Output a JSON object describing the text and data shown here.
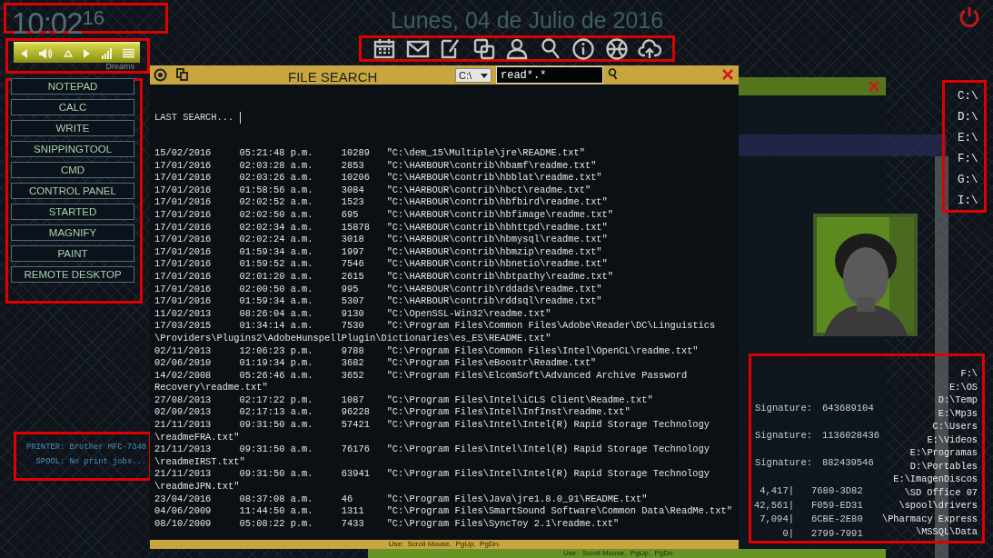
{
  "clock": {
    "time": "10:02",
    "seconds": "16",
    "highlighted": true
  },
  "date": "Lunes, 04 de Julio de 2016",
  "toolbar": {
    "highlighted": true
  },
  "media_player": {
    "label": "Dreams",
    "highlighted": true
  },
  "launcher": {
    "highlighted": true,
    "buttons": [
      "NOTEPAD",
      "CALC",
      "WRITE",
      "SNIPPINGTOOL",
      "CMD",
      "CONTROL PANEL",
      "STARTED",
      "MAGNIFY",
      "PAINT",
      "REMOTE DESKTOP"
    ]
  },
  "printer_status": {
    "highlighted": true,
    "printer": "PRINTER: Brother MFC-7340",
    "spool": "SPOOL: No print jobs..."
  },
  "file_search": {
    "title": "FILE SEARCH",
    "drive": "C:\\",
    "query": "read*.*",
    "last_search": "LAST SEARCH...",
    "footer": "Use:  Scroll Mouse,  PgUp,  PgDn.",
    "results": [
      {
        "date": "15/02/2016",
        "time": "05:21:48 p.m.",
        "size": "10289",
        "path": "\"C:\\dem_15\\Multiple\\jre\\README.txt\""
      },
      {
        "date": "17/01/2016",
        "time": "02:03:28 a.m.",
        "size": "2853",
        "path": "\"C:\\HARBOUR\\contrib\\hbamf\\readme.txt\""
      },
      {
        "date": "17/01/2016",
        "time": "02:03:26 a.m.",
        "size": "10206",
        "path": "\"C:\\HARBOUR\\contrib\\hbblat\\readme.txt\""
      },
      {
        "date": "17/01/2016",
        "time": "01:58:56 a.m.",
        "size": "3084",
        "path": "\"C:\\HARBOUR\\contrib\\hbct\\readme.txt\""
      },
      {
        "date": "17/01/2016",
        "time": "02:02:52 a.m.",
        "size": "1523",
        "path": "\"C:\\HARBOUR\\contrib\\hbfbird\\readme.txt\""
      },
      {
        "date": "17/01/2016",
        "time": "02:02:50 a.m.",
        "size": "695",
        "path": "\"C:\\HARBOUR\\contrib\\hbfimage\\readme.txt\""
      },
      {
        "date": "17/01/2016",
        "time": "02:02:34 a.m.",
        "size": "15878",
        "path": "\"C:\\HARBOUR\\contrib\\hbhttpd\\readme.txt\""
      },
      {
        "date": "17/01/2016",
        "time": "02:02:24 a.m.",
        "size": "3018",
        "path": "\"C:\\HARBOUR\\contrib\\hbmysql\\readme.txt\""
      },
      {
        "date": "17/01/2016",
        "time": "01:59:34 a.m.",
        "size": "1997",
        "path": "\"C:\\HARBOUR\\contrib\\hbmzip\\readme.txt\""
      },
      {
        "date": "17/01/2016",
        "time": "01:59:52 a.m.",
        "size": "7546",
        "path": "\"C:\\HARBOUR\\contrib\\hbnetio\\readme.txt\""
      },
      {
        "date": "17/01/2016",
        "time": "02:01:20 a.m.",
        "size": "2615",
        "path": "\"C:\\HARBOUR\\contrib\\hbtpathy\\readme.txt\""
      },
      {
        "date": "17/01/2016",
        "time": "02:00:50 a.m.",
        "size": "995",
        "path": "\"C:\\HARBOUR\\contrib\\rddads\\readme.txt\""
      },
      {
        "date": "17/01/2016",
        "time": "01:59:34 a.m.",
        "size": "5307",
        "path": "\"C:\\HARBOUR\\contrib\\rddsql\\readme.txt\""
      },
      {
        "date": "11/02/2013",
        "time": "08:26:04 a.m.",
        "size": "9130",
        "path": "\"C:\\OpenSSL-Win32\\readme.txt\""
      },
      {
        "date": "17/03/2015",
        "time": "01:34:14 a.m.",
        "size": "7530",
        "path": "\"C:\\Program Files\\Common Files\\Adobe\\Reader\\DC\\Linguistics\\Providers\\Plugins2\\AdobeHunspellPlugin\\Dictionaries\\es_ES\\README.txt\""
      },
      {
        "date": "02/11/2013",
        "time": "12:06:23 p.m.",
        "size": "9788",
        "path": "\"C:\\Program Files\\Common Files\\Intel\\OpenCL\\readme.txt\""
      },
      {
        "date": "02/06/2010",
        "time": "01:19:34 p.m.",
        "size": "3682",
        "path": "\"C:\\Program Files\\eBoostr\\Readme.txt\""
      },
      {
        "date": "14/02/2008",
        "time": "05:26:46 a.m.",
        "size": "3652",
        "path": "\"C:\\Program Files\\ElcomSoft\\Advanced Archive Password Recovery\\readme.txt\""
      },
      {
        "date": "27/08/2013",
        "time": "02:17:22 p.m.",
        "size": "1087",
        "path": "\"C:\\Program Files\\Intel\\iCLS Client\\Readme.txt\""
      },
      {
        "date": "02/09/2013",
        "time": "02:17:13 a.m.",
        "size": "96228",
        "path": "\"C:\\Program Files\\Intel\\InfInst\\readme.txt\""
      },
      {
        "date": "21/11/2013",
        "time": "09:31:50 a.m.",
        "size": "57421",
        "path": "\"C:\\Program Files\\Intel\\Intel(R) Rapid Storage Technology\\readmeFRA.txt\""
      },
      {
        "date": "21/11/2013",
        "time": "09:31:50 a.m.",
        "size": "76176",
        "path": "\"C:\\Program Files\\Intel\\Intel(R) Rapid Storage Technology\\readmeIRST.txt\""
      },
      {
        "date": "21/11/2013",
        "time": "09:31:50 a.m.",
        "size": "63941",
        "path": "\"C:\\Program Files\\Intel\\Intel(R) Rapid Storage Technology\\readmeJPN.txt\""
      },
      {
        "date": "23/04/2016",
        "time": "08:37:08 a.m.",
        "size": "46",
        "path": "\"C:\\Program Files\\Java\\jre1.8.0_91\\README.txt\""
      },
      {
        "date": "04/06/2009",
        "time": "11:44:50 a.m.",
        "size": "1311",
        "path": "\"C:\\Program Files\\SmartSound Software\\Common Data\\ReadMe.txt\""
      },
      {
        "date": "08/10/2009",
        "time": "05:08:22 p.m.",
        "size": "7433",
        "path": "\"C:\\Program Files\\SyncToy 2.1\\readme.txt\""
      }
    ]
  },
  "system_info": {
    "footer": "Use:  Scroll Mouse,  PgUp,  PgDn.",
    "signatures": [
      {
        "label": "Signature:",
        "value": "643689104"
      },
      {
        "label": "Signature:",
        "value": "1136028436"
      },
      {
        "label": "Signature:",
        "value": "882439546"
      }
    ],
    "volumes": [
      {
        "size": "4,417|",
        "serial": "7680-3D82"
      },
      {
        "size": "42,561|",
        "serial": "F059-ED31"
      },
      {
        "size": "7,094|",
        "serial": "6CBE-2E80"
      },
      {
        "size": "0|",
        "serial": "2799-7991"
      }
    ]
  },
  "drives": {
    "highlighted": true,
    "items": [
      "C:\\",
      "D:\\",
      "E:\\",
      "F:\\",
      "G:\\",
      "I:\\"
    ]
  },
  "folders": {
    "highlighted": true,
    "items": [
      "F:\\",
      "E:\\OS",
      "D:\\Temp",
      "E:\\Mp3s",
      "C:\\Users",
      "E:\\Videos",
      "E:\\Programas",
      "D:\\Portables",
      "E:\\ImagenDiscos",
      "\\SD Office 07",
      "\\spool\\drivers",
      "\\Pharmacy Express",
      "\\MSSQL\\Data"
    ]
  }
}
